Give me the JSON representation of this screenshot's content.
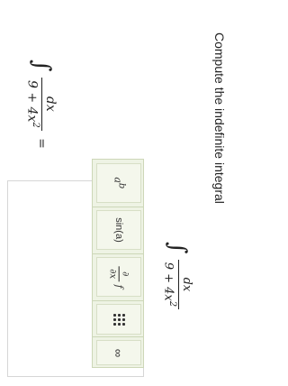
{
  "prompt": "Compute the indefinite integral",
  "integral": {
    "symbol": "∫",
    "numerator": "dx",
    "denominator_base": "9 + 4x",
    "denominator_exp": "2",
    "equals": "="
  },
  "toolbar": {
    "power_base": "a",
    "power_exp": "b",
    "sin_label": "sin(a)",
    "deriv_num": "∂",
    "deriv_den": "∂x",
    "deriv_f": "f",
    "infinity": "∞"
  },
  "colors": {
    "toolbar_bg": "#eef3e4",
    "toolbar_border": "#cdd7b8"
  }
}
